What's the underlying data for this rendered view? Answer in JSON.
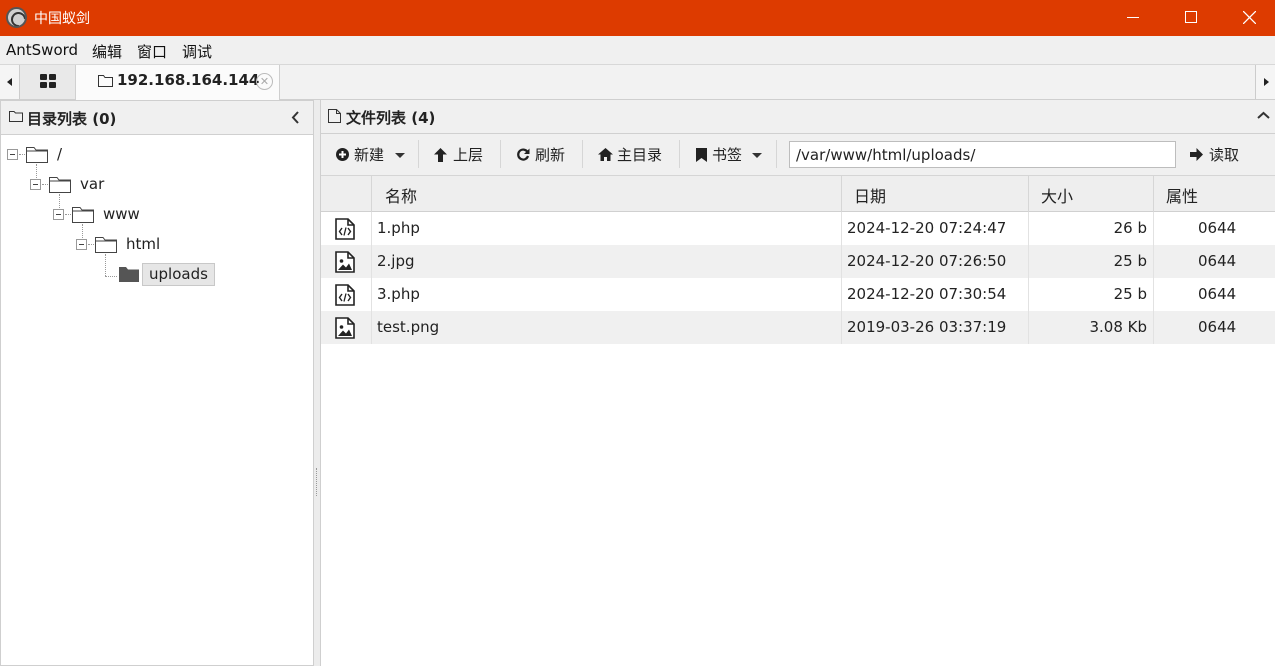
{
  "window": {
    "title": "中国蚁剑",
    "controls": {
      "minimize": "minimize-icon",
      "maximize": "maximize-icon",
      "close": "close-icon"
    }
  },
  "menu": [
    {
      "label": "AntSword"
    },
    {
      "label": "编辑"
    },
    {
      "label": "窗口"
    },
    {
      "label": "调试"
    }
  ],
  "tabs": {
    "home_icon": "grid-icon",
    "active": {
      "label": "192.168.164.144",
      "icon": "folder-icon"
    }
  },
  "left_panel": {
    "title": "目录列表 (0)",
    "tree": [
      {
        "label": "/",
        "depth": 0
      },
      {
        "label": "var",
        "depth": 1
      },
      {
        "label": "www",
        "depth": 2
      },
      {
        "label": "html",
        "depth": 3
      },
      {
        "label": "uploads",
        "depth": 4,
        "selected": true
      }
    ]
  },
  "right_panel": {
    "title": "文件列表 (4)",
    "toolbar": {
      "new_label": "新建",
      "up_label": "上层",
      "refresh_label": "刷新",
      "home_label": "主目录",
      "bookmark_label": "书签",
      "path_value": "/var/www/html/uploads/",
      "read_label": "读取"
    },
    "columns": {
      "name": "名称",
      "date": "日期",
      "size": "大小",
      "attr": "属性"
    },
    "files": [
      {
        "name": "1.php",
        "date": "2024-12-20 07:24:47",
        "size": "26 b",
        "attr": "0644",
        "type": "code"
      },
      {
        "name": "2.jpg",
        "date": "2024-12-20 07:26:50",
        "size": "25 b",
        "attr": "0644",
        "type": "image"
      },
      {
        "name": "3.php",
        "date": "2024-12-20 07:30:54",
        "size": "25 b",
        "attr": "0644",
        "type": "code"
      },
      {
        "name": "test.png",
        "date": "2019-03-26 03:37:19",
        "size": "3.08 Kb",
        "attr": "0644",
        "type": "image"
      }
    ]
  },
  "colors": {
    "titlebar": "#dd3b00",
    "accent_text": "#ffffff"
  }
}
